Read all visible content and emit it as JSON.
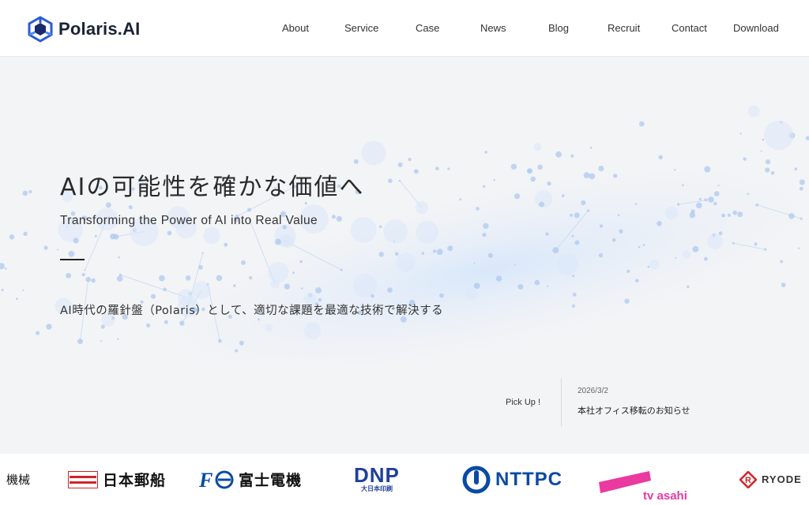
{
  "brand": {
    "name": "Polaris.AI",
    "logo_icon": "polaris-cube-logo",
    "accent": "#2a5bd7"
  },
  "nav": {
    "items": [
      "About",
      "Service",
      "Case",
      "News",
      "Blog",
      "Recruit",
      "Contact",
      "Download"
    ]
  },
  "hero": {
    "title": "AIの可能性を確かな価値へ",
    "subtitle": "Transforming the Power of AI into Real Value",
    "lead": "AI時代の羅針盤（Polaris）として、適切な課題を最適な技術で解決する"
  },
  "pickup": {
    "label": "Pick Up !",
    "date": "2026/3/2",
    "title": "本社オフィス移転のお知らせ"
  },
  "clients": {
    "items": [
      {
        "text": "機械"
      },
      {
        "text": "日本郵船"
      },
      {
        "text": "富士電機"
      },
      {
        "text": "DNP",
        "sub": "大日本印刷"
      },
      {
        "text": "NTTPC"
      },
      {
        "text": "tv asahi"
      },
      {
        "text": "RYODE"
      }
    ],
    "colors": {
      "nyk_red": "#d2232a",
      "fuji_blue": "#0a4aa3",
      "dnp_blue": "#1f3f9c",
      "ntt_blue": "#0a4aa3",
      "tvasahi_pink": "#ea3aa0"
    }
  }
}
